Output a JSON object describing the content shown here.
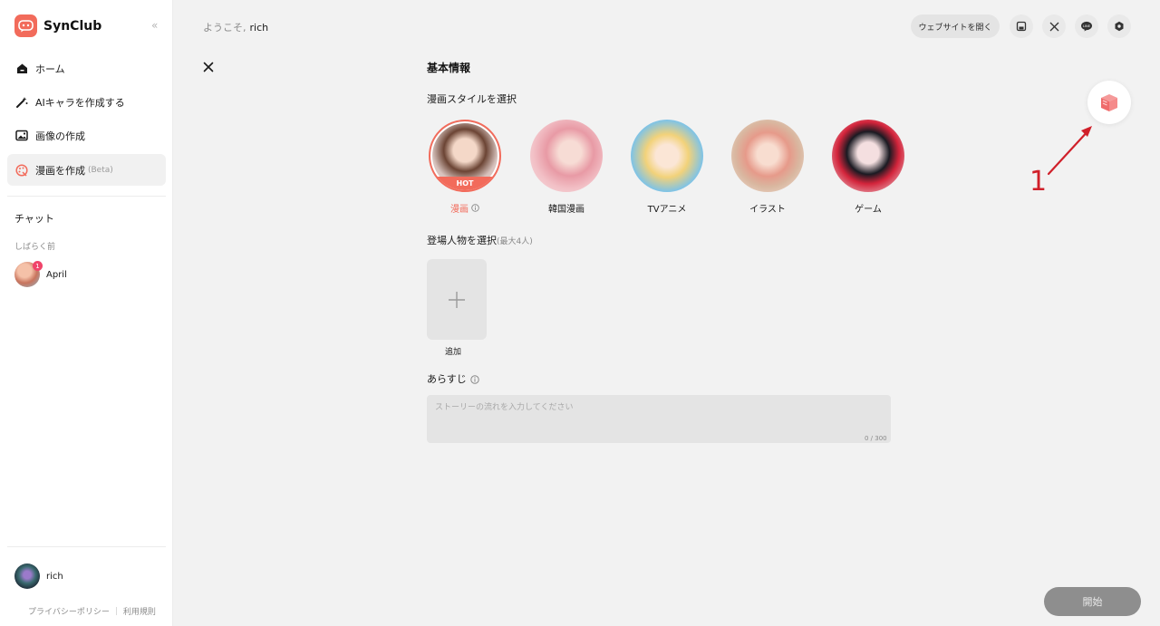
{
  "app": {
    "name": "SynClub",
    "accent": "#f26b5b"
  },
  "sidebar": {
    "items": [
      {
        "label": "ホーム",
        "icon": "home-icon"
      },
      {
        "label": "AIキャラを作成する",
        "icon": "magic-wand-icon"
      },
      {
        "label": "画像の作成",
        "icon": "image-icon"
      },
      {
        "label": "漫画を作成",
        "beta": "(Beta)",
        "icon": "palette-icon",
        "active": true
      }
    ],
    "chat_title": "チャット",
    "chat_group": "しばらく前",
    "chats": [
      {
        "name": "April",
        "unread": "1"
      }
    ],
    "user": {
      "name": "rich"
    },
    "footer": {
      "privacy": "プライバシーポリシー",
      "terms": "利用規則"
    }
  },
  "header": {
    "welcome": "ようこそ,",
    "username": "rich",
    "open_site": "ウェブサイトを開く",
    "icons": [
      "save-icon",
      "x-twitter-icon",
      "line-icon",
      "settings-icon"
    ]
  },
  "form": {
    "title": "基本情報",
    "style_label": "漫画スタイルを選択",
    "styles": [
      {
        "label": "漫画",
        "hot": "HOT",
        "selected": true
      },
      {
        "label": "韓国漫画"
      },
      {
        "label": "TVアニメ"
      },
      {
        "label": "イラスト"
      },
      {
        "label": "ゲーム"
      }
    ],
    "characters_label": "登場人物を選択",
    "characters_note": "(最大4人)",
    "add_label": "追加",
    "story_label": "あらすじ",
    "story_placeholder": "ストーリーの流れを入力してください",
    "story_value": "",
    "counter": "0 / 300",
    "start": "開始"
  },
  "annotation": {
    "number": "1",
    "color": "#d0202a"
  }
}
